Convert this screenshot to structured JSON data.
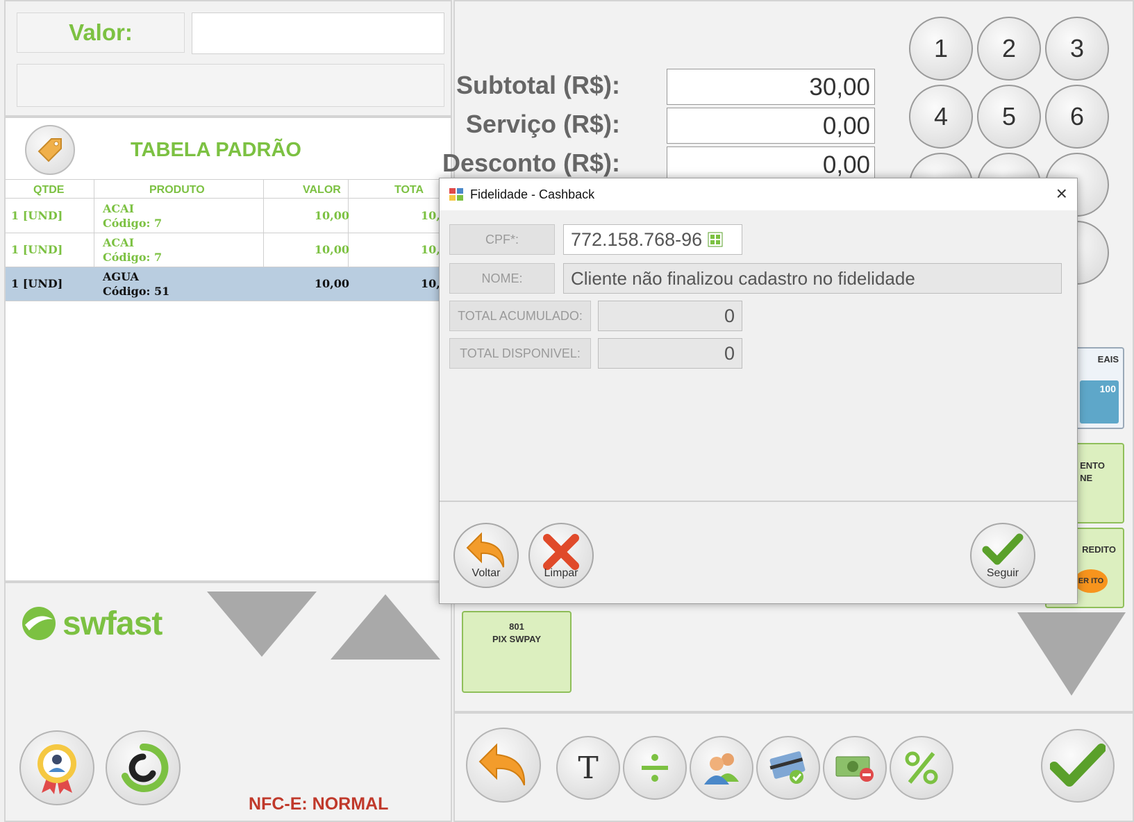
{
  "left": {
    "valor_label": "Valor:",
    "valor_value": "",
    "table_title": "TABELA PADRÃO",
    "columns": [
      "QTDE",
      "PRODUTO",
      "VALOR",
      "TOTA"
    ],
    "rows": [
      {
        "qty": "1 [UND]",
        "name": "ACAI",
        "code": "Código: 7",
        "value": "10,00",
        "total": "10,("
      },
      {
        "qty": "1 [UND]",
        "name": "ACAI",
        "code": "Código: 7",
        "value": "10,00",
        "total": "10,("
      },
      {
        "qty": "1 [UND]",
        "name": "AGUA",
        "code": "Código: 51",
        "value": "10,00",
        "total": "10,("
      }
    ],
    "logo_text": "swfast",
    "status": "NFC-E: NORMAL"
  },
  "summary": {
    "subtotal_label": "Subtotal (R$):",
    "subtotal_value": "30,00",
    "servico_label": "Serviço (R$):",
    "servico_value": "0,00",
    "desconto_label": "Desconto (R$):",
    "desconto_value": "0,00"
  },
  "keypad": [
    "1",
    "2",
    "3",
    "4",
    "5",
    "6"
  ],
  "payment_tiles": {
    "pix_code": "801",
    "pix_name": "PIX SWPAY",
    "partial_1": "EAIS",
    "partial_1_note": "100",
    "partial_2_line1": "ENTO",
    "partial_2_line2": "NE",
    "partial_3": "REDITO",
    "partial_3_badge": "ER ITO"
  },
  "toolbar": {
    "text_btn": "T"
  },
  "modal": {
    "title": "Fidelidade - Cashback",
    "close": "×",
    "cpf_label": "CPF*:",
    "cpf_value": "772.158.768-96",
    "nome_label": "NOME:",
    "nome_value": "Cliente não finalizou cadastro no fidelidade",
    "acumulado_label": "TOTAL ACUMULADO:",
    "acumulado_value": "0",
    "disponivel_label": "TOTAL DISPONIVEL:",
    "disponivel_value": "0",
    "voltar_label": "Voltar",
    "limpar_label": "Limpar",
    "seguir_label": "Seguir"
  },
  "colors": {
    "accent_green": "#7cc142",
    "selected_row": "#b9cde0",
    "status_red": "#c0392b",
    "arrow_orange": "#f39c2b"
  }
}
